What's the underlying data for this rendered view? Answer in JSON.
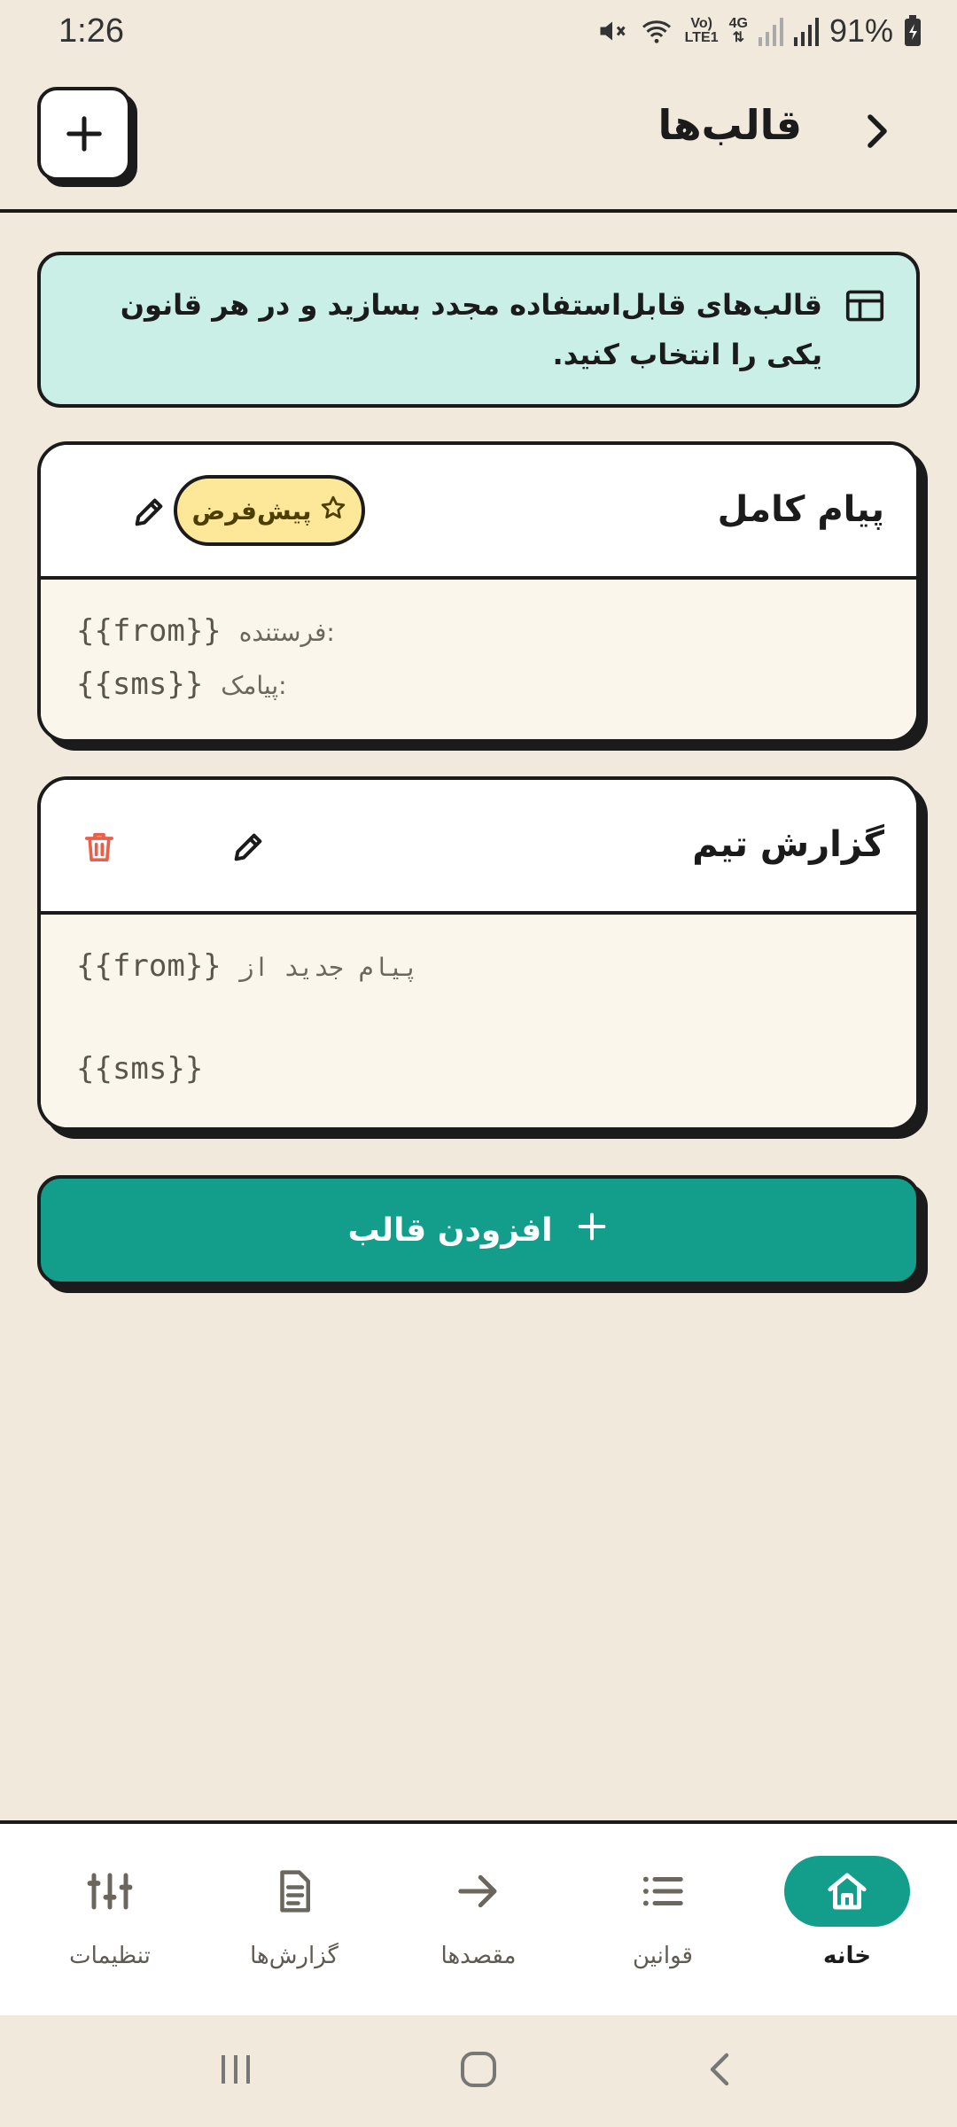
{
  "status_bar": {
    "time": "1:26",
    "battery": "91%",
    "network_top": "Vo)",
    "network_bottom": "LTE1",
    "network_4g": "4G"
  },
  "header": {
    "title": "قالب‌ها"
  },
  "info": {
    "text": "قالب‌های قابل‌استفاده مجدد بسازید و در هر قانون یکی را انتخاب کنید."
  },
  "templates": [
    {
      "title": "پیام کامل",
      "badge": "پیش‌فرض",
      "lines": [
        {
          "label": "فرستنده:",
          "value": "{{from}}"
        },
        {
          "label": "پیامک:",
          "value": "{{sms}}"
        }
      ]
    },
    {
      "title": "گزارش تیم",
      "lines": [
        {
          "label": "پیام جدید از",
          "value": "{{from}}"
        },
        {
          "label": "",
          "value": "{{sms}}"
        }
      ]
    }
  ],
  "add_button": {
    "label": "افزودن قالب"
  },
  "bottom_nav": {
    "items": [
      {
        "label": "خانه",
        "icon": "home-icon",
        "active": true
      },
      {
        "label": "قوانین",
        "icon": "list-icon",
        "active": false
      },
      {
        "label": "مقصدها",
        "icon": "arrow-right-icon",
        "active": false
      },
      {
        "label": "گزارش‌ها",
        "icon": "document-icon",
        "active": false
      },
      {
        "label": "تنظیمات",
        "icon": "sliders-icon",
        "active": false
      }
    ]
  },
  "colors": {
    "background": "#f0e9dc",
    "accent": "#129e8b",
    "info_bg": "#c9efe6",
    "badge_bg": "#fde89a",
    "delete": "#e8604c"
  }
}
